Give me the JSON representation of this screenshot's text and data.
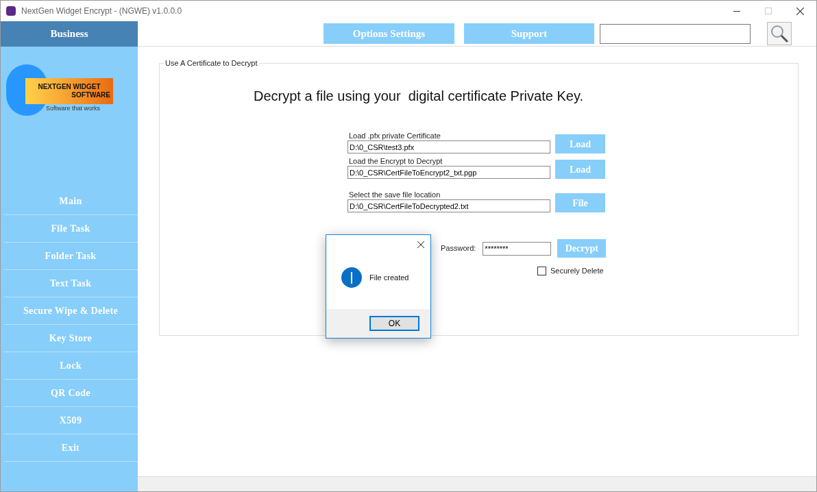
{
  "window": {
    "title": "NextGen Widget Encrypt - (NGWE) v1.0.0.0"
  },
  "sidebar": {
    "header": "Business",
    "logo": {
      "line1": "NEXTGEN WIDGET",
      "line2": "SOFTWARE",
      "tagline": "Software that works"
    },
    "items": [
      {
        "label": "Main"
      },
      {
        "label": "File Task"
      },
      {
        "label": "Folder Task"
      },
      {
        "label": "Text Task"
      },
      {
        "label": "Secure Wipe & Delete"
      },
      {
        "label": "Key Store"
      },
      {
        "label": "Lock"
      },
      {
        "label": "QR Code"
      },
      {
        "label": "X509"
      },
      {
        "label": "Exit"
      }
    ]
  },
  "toolbar": {
    "buttons": [
      "Options Settings",
      "Support"
    ]
  },
  "group": {
    "title": "Use A Certificate to Decrypt",
    "heading": "Decrypt a file using your  digital certificate Private Key.",
    "fields": [
      {
        "label": "Load .pfx private Certificate",
        "value": "D:\\0_CSR\\test3.pfx",
        "button": "Load"
      },
      {
        "label": "Load the Encrypt to Decrypt",
        "value": "D:\\0_CSR\\CertFileToEncrypt2_txt.pgp",
        "button": "Load"
      },
      {
        "label": "Select the save file location",
        "value": "D:\\0_CSR\\CertFileToDecrypted2.txt",
        "button": "File"
      }
    ],
    "password": {
      "label": "Password:",
      "value": "********",
      "button": "Decrypt"
    },
    "secure_delete": {
      "label": "Securely Delete",
      "checked": false
    }
  },
  "dialog": {
    "message": "File created",
    "button": "OK"
  }
}
